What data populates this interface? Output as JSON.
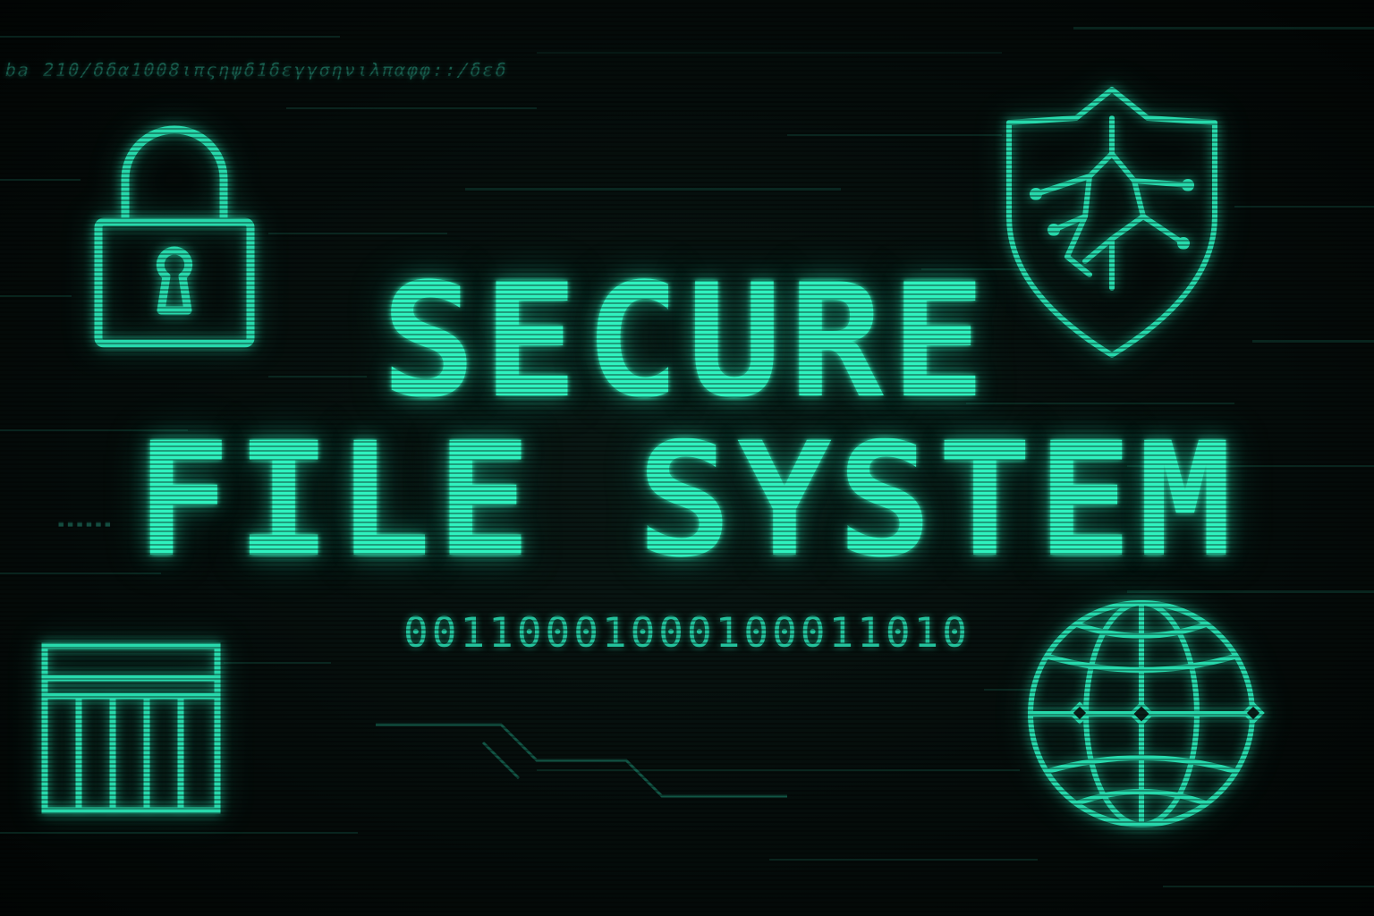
{
  "header": {
    "code_strip": "ba 210/δδα1008ιπςηψδ1δεγγσηνιλπαφφ::/δεδ"
  },
  "title": {
    "line1": "SECURE",
    "line2": "FILE SYSTEM"
  },
  "binary": "00110001000100011010",
  "colors": {
    "background": "#030807",
    "accent": "#2ff2bf",
    "accent_dim": "#23c29c"
  },
  "icons": {
    "top_left": "lock-icon",
    "top_right": "shield-icon",
    "bottom_left": "grid-icon",
    "bottom_right": "globe-icon"
  }
}
